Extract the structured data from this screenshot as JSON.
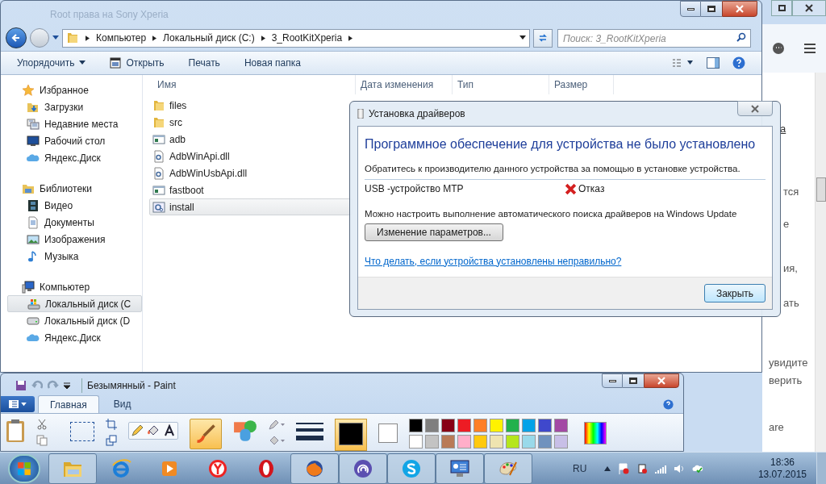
{
  "browser": {
    "tab_title": "Root права на Sony Xperia",
    "page_fragments": [
      {
        "text": "а",
        "kind": "link"
      },
      {
        "text": "тся",
        "kind": "text"
      },
      {
        "text": "е",
        "kind": "text"
      },
      {
        "text": "ия,",
        "kind": "text"
      },
      {
        "text": "ать",
        "kind": "text"
      },
      {
        "text": "увидите",
        "kind": "text"
      },
      {
        "text": "верить",
        "kind": "text"
      },
      {
        "text": "are",
        "kind": "text"
      }
    ]
  },
  "explorer": {
    "breadcrumb": [
      "Компьютер",
      "Локальный диск (C:)",
      "3_RootKitXperia"
    ],
    "search": {
      "placeholder": "Поиск: 3_RootKitXperia"
    },
    "toolbar": [
      {
        "label": "Упорядочить",
        "kind": "menu"
      },
      {
        "label": "Открыть",
        "kind": "open"
      },
      {
        "label": "Печать",
        "kind": "plain"
      },
      {
        "label": "Новая папка",
        "kind": "plain"
      }
    ],
    "nav": [
      {
        "label": "Избранное",
        "kind": "star",
        "selected": false,
        "children": [
          {
            "label": "Загрузки",
            "kind": "download",
            "selected": false
          },
          {
            "label": "Недавние места",
            "kind": "recent",
            "selected": false
          },
          {
            "label": "Рабочий стол",
            "kind": "desktop",
            "selected": false
          },
          {
            "label": "Яндекс.Диск",
            "kind": "cloud",
            "selected": false
          }
        ]
      },
      {
        "label": "Библиотеки",
        "kind": "library",
        "selected": false,
        "children": [
          {
            "label": "Видео",
            "kind": "film",
            "selected": false
          },
          {
            "label": "Документы",
            "kind": "document",
            "selected": false
          },
          {
            "label": "Изображения",
            "kind": "picture",
            "selected": false
          },
          {
            "label": "Музыка",
            "kind": "music",
            "selected": false
          }
        ]
      },
      {
        "label": "Компьютер",
        "kind": "computer",
        "selected": false,
        "children": [
          {
            "label": "Локальный диск (C",
            "kind": "windrive",
            "selected": true
          },
          {
            "label": "Локальный диск (D",
            "kind": "drive",
            "selected": false
          },
          {
            "label": "Яндекс.Диск",
            "kind": "cloud",
            "selected": false
          }
        ]
      }
    ],
    "columns": [
      "Имя",
      "Дата изменения",
      "Тип",
      "Размер"
    ],
    "files": [
      {
        "name": "files",
        "kind": "folder",
        "selected": false
      },
      {
        "name": "src",
        "kind": "folder",
        "selected": false
      },
      {
        "name": "adb",
        "kind": "app",
        "selected": false
      },
      {
        "name": "AdbWinApi.dll",
        "kind": "dll",
        "selected": false
      },
      {
        "name": "AdbWinUsbApi.dll",
        "kind": "dll",
        "selected": false
      },
      {
        "name": "fastboot",
        "kind": "app",
        "selected": false
      },
      {
        "name": "install",
        "kind": "script",
        "selected": true
      }
    ]
  },
  "dialog": {
    "title": "Установка драйверов",
    "heading": "Программное обеспечение для устройства не было установлено",
    "message": "Обратитесь к производителю данного устройства за помощью в установке устройства.",
    "device": {
      "name": "USB -устройство MTP",
      "status": "Отказ",
      "failed": true
    },
    "update_note": "Можно настроить выполнение автоматического поиска драйверов на Windows Update",
    "settings_button": "Изменение параметров...",
    "help_link": "Что делать, если устройства установлены неправильно?",
    "close_button": "Закрыть"
  },
  "paint": {
    "title": "Безымянный - Paint",
    "tabs": [
      {
        "label": "Главная",
        "selected": true
      },
      {
        "label": "Вид",
        "selected": false
      }
    ],
    "current_colors": [
      {
        "color": "#000000"
      },
      {
        "color": "#ffffff"
      }
    ],
    "palette": [
      {
        "color": "#000000"
      },
      {
        "color": "#7f7f7f"
      },
      {
        "color": "#880015"
      },
      {
        "color": "#ed1c24"
      },
      {
        "color": "#ff7f27"
      },
      {
        "color": "#fff200"
      },
      {
        "color": "#22b14c"
      },
      {
        "color": "#00a2e8"
      },
      {
        "color": "#3f48cc"
      },
      {
        "color": "#a349a4"
      },
      {
        "color": "#ffffff"
      },
      {
        "color": "#c3c3c3"
      },
      {
        "color": "#b97a57"
      },
      {
        "color": "#ffaec9"
      },
      {
        "color": "#ffc90e"
      },
      {
        "color": "#efe4b0"
      },
      {
        "color": "#b5e61d"
      },
      {
        "color": "#99d9ea"
      },
      {
        "color": "#7092be"
      },
      {
        "color": "#c8bfe7"
      }
    ]
  },
  "taskbar": {
    "apps": [
      {
        "kind": "explorer",
        "running": true
      },
      {
        "kind": "ie",
        "running": false
      },
      {
        "kind": "media",
        "running": false
      },
      {
        "kind": "yandex",
        "running": false
      },
      {
        "kind": "opera",
        "running": false
      },
      {
        "kind": "firefox",
        "running": true
      },
      {
        "kind": "torrent",
        "running": true
      },
      {
        "kind": "skype",
        "running": true
      },
      {
        "kind": "control",
        "running": true
      },
      {
        "kind": "paint",
        "running": true
      }
    ],
    "language": "RU",
    "time": "18:36",
    "date": "13.07.2015"
  }
}
